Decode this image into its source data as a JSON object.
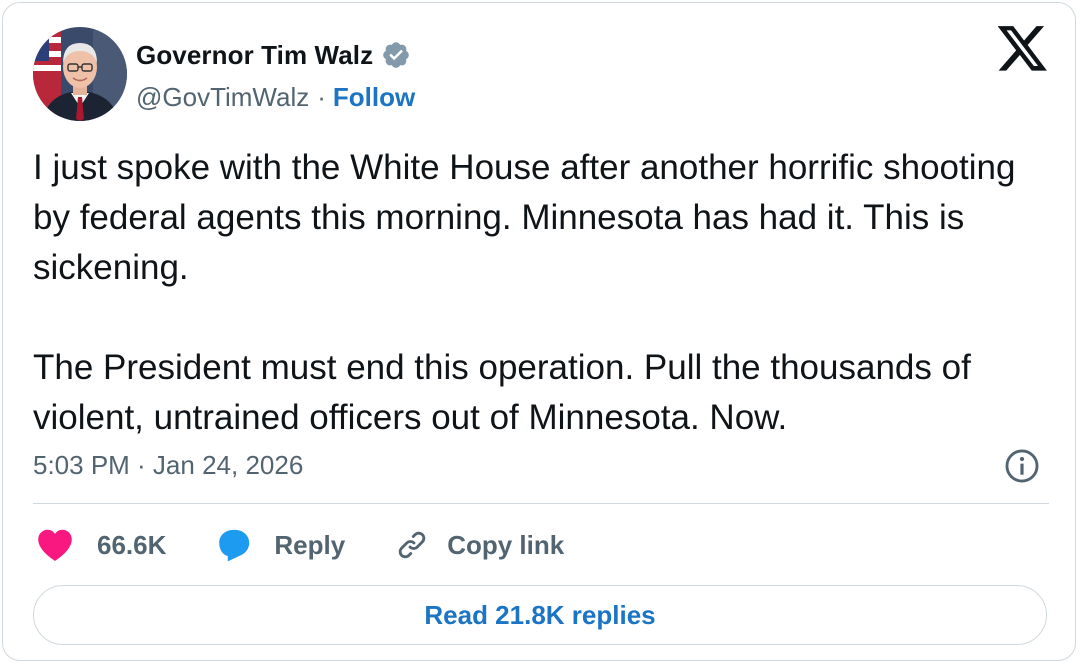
{
  "author": {
    "display_name": "Governor Tim Walz",
    "handle": "@GovTimWalz",
    "separator": "·",
    "follow_label": "Follow",
    "verified_badge_color": "#829aab",
    "avatar_icon": "profile-photo"
  },
  "tweet": {
    "paragraphs": [
      "I just spoke with the White House after another horrific shooting by federal agents this morning. Minnesota has had it. This is sickening.",
      "The President must end this operation. Pull the thousands of violent, untrained officers out of Minnesota. Now."
    ],
    "timestamp": "5:03 PM · Jan 24, 2026"
  },
  "actions": {
    "like_count": "66.6K",
    "reply_label": "Reply",
    "copy_link_label": "Copy link",
    "read_replies_label": "Read 21.8K replies"
  },
  "colors": {
    "text_primary": "#0f1419",
    "text_secondary": "#536471",
    "link_blue": "#1b74c4",
    "like_pink": "#f91880",
    "reply_blue": "#1d9bf0",
    "border": "#cfd9de"
  },
  "icons": {
    "brand": "x-logo-icon",
    "verified": "verified-badge-icon",
    "info": "info-icon",
    "like": "heart-icon",
    "reply": "reply-bubble-icon",
    "copy": "link-icon"
  }
}
